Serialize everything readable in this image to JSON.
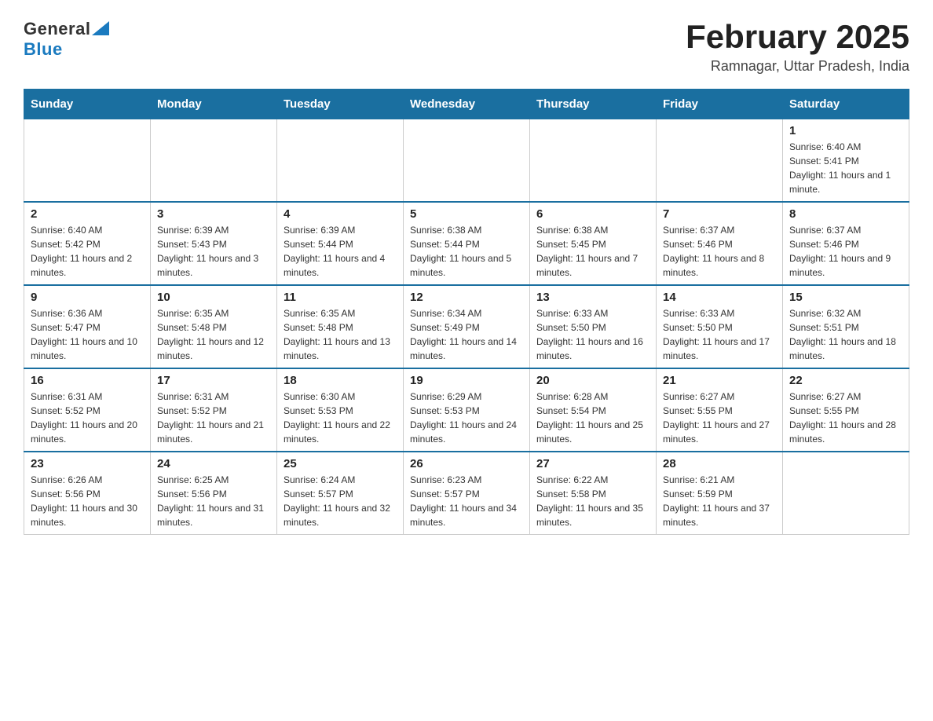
{
  "header": {
    "logo_general": "General",
    "logo_blue": "Blue",
    "month_title": "February 2025",
    "location": "Ramnagar, Uttar Pradesh, India"
  },
  "weekdays": [
    "Sunday",
    "Monday",
    "Tuesday",
    "Wednesday",
    "Thursday",
    "Friday",
    "Saturday"
  ],
  "weeks": [
    [
      {
        "day": "",
        "info": ""
      },
      {
        "day": "",
        "info": ""
      },
      {
        "day": "",
        "info": ""
      },
      {
        "day": "",
        "info": ""
      },
      {
        "day": "",
        "info": ""
      },
      {
        "day": "",
        "info": ""
      },
      {
        "day": "1",
        "info": "Sunrise: 6:40 AM\nSunset: 5:41 PM\nDaylight: 11 hours and 1 minute."
      }
    ],
    [
      {
        "day": "2",
        "info": "Sunrise: 6:40 AM\nSunset: 5:42 PM\nDaylight: 11 hours and 2 minutes."
      },
      {
        "day": "3",
        "info": "Sunrise: 6:39 AM\nSunset: 5:43 PM\nDaylight: 11 hours and 3 minutes."
      },
      {
        "day": "4",
        "info": "Sunrise: 6:39 AM\nSunset: 5:44 PM\nDaylight: 11 hours and 4 minutes."
      },
      {
        "day": "5",
        "info": "Sunrise: 6:38 AM\nSunset: 5:44 PM\nDaylight: 11 hours and 5 minutes."
      },
      {
        "day": "6",
        "info": "Sunrise: 6:38 AM\nSunset: 5:45 PM\nDaylight: 11 hours and 7 minutes."
      },
      {
        "day": "7",
        "info": "Sunrise: 6:37 AM\nSunset: 5:46 PM\nDaylight: 11 hours and 8 minutes."
      },
      {
        "day": "8",
        "info": "Sunrise: 6:37 AM\nSunset: 5:46 PM\nDaylight: 11 hours and 9 minutes."
      }
    ],
    [
      {
        "day": "9",
        "info": "Sunrise: 6:36 AM\nSunset: 5:47 PM\nDaylight: 11 hours and 10 minutes."
      },
      {
        "day": "10",
        "info": "Sunrise: 6:35 AM\nSunset: 5:48 PM\nDaylight: 11 hours and 12 minutes."
      },
      {
        "day": "11",
        "info": "Sunrise: 6:35 AM\nSunset: 5:48 PM\nDaylight: 11 hours and 13 minutes."
      },
      {
        "day": "12",
        "info": "Sunrise: 6:34 AM\nSunset: 5:49 PM\nDaylight: 11 hours and 14 minutes."
      },
      {
        "day": "13",
        "info": "Sunrise: 6:33 AM\nSunset: 5:50 PM\nDaylight: 11 hours and 16 minutes."
      },
      {
        "day": "14",
        "info": "Sunrise: 6:33 AM\nSunset: 5:50 PM\nDaylight: 11 hours and 17 minutes."
      },
      {
        "day": "15",
        "info": "Sunrise: 6:32 AM\nSunset: 5:51 PM\nDaylight: 11 hours and 18 minutes."
      }
    ],
    [
      {
        "day": "16",
        "info": "Sunrise: 6:31 AM\nSunset: 5:52 PM\nDaylight: 11 hours and 20 minutes."
      },
      {
        "day": "17",
        "info": "Sunrise: 6:31 AM\nSunset: 5:52 PM\nDaylight: 11 hours and 21 minutes."
      },
      {
        "day": "18",
        "info": "Sunrise: 6:30 AM\nSunset: 5:53 PM\nDaylight: 11 hours and 22 minutes."
      },
      {
        "day": "19",
        "info": "Sunrise: 6:29 AM\nSunset: 5:53 PM\nDaylight: 11 hours and 24 minutes."
      },
      {
        "day": "20",
        "info": "Sunrise: 6:28 AM\nSunset: 5:54 PM\nDaylight: 11 hours and 25 minutes."
      },
      {
        "day": "21",
        "info": "Sunrise: 6:27 AM\nSunset: 5:55 PM\nDaylight: 11 hours and 27 minutes."
      },
      {
        "day": "22",
        "info": "Sunrise: 6:27 AM\nSunset: 5:55 PM\nDaylight: 11 hours and 28 minutes."
      }
    ],
    [
      {
        "day": "23",
        "info": "Sunrise: 6:26 AM\nSunset: 5:56 PM\nDaylight: 11 hours and 30 minutes."
      },
      {
        "day": "24",
        "info": "Sunrise: 6:25 AM\nSunset: 5:56 PM\nDaylight: 11 hours and 31 minutes."
      },
      {
        "day": "25",
        "info": "Sunrise: 6:24 AM\nSunset: 5:57 PM\nDaylight: 11 hours and 32 minutes."
      },
      {
        "day": "26",
        "info": "Sunrise: 6:23 AM\nSunset: 5:57 PM\nDaylight: 11 hours and 34 minutes."
      },
      {
        "day": "27",
        "info": "Sunrise: 6:22 AM\nSunset: 5:58 PM\nDaylight: 11 hours and 35 minutes."
      },
      {
        "day": "28",
        "info": "Sunrise: 6:21 AM\nSunset: 5:59 PM\nDaylight: 11 hours and 37 minutes."
      },
      {
        "day": "",
        "info": ""
      }
    ]
  ]
}
